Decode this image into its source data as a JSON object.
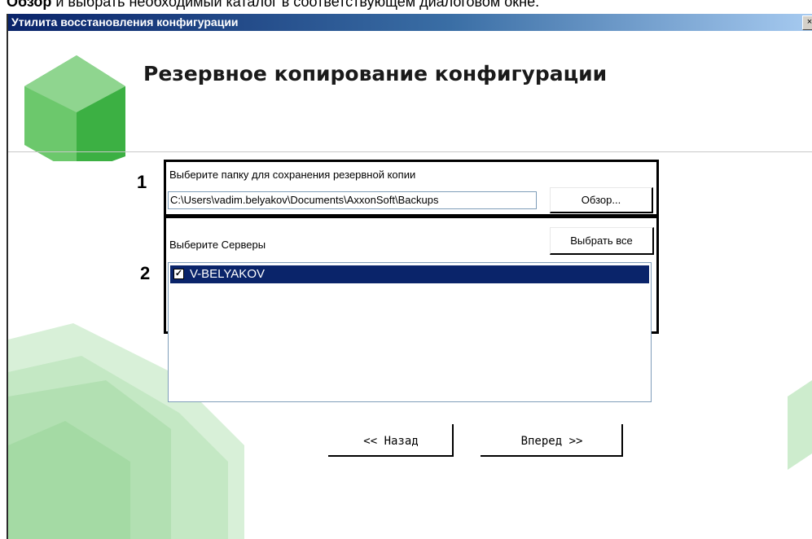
{
  "doc_caption": {
    "bold": "Обзор",
    "rest": " и выбрать необходимый каталог в соответствующем диалоговом окне."
  },
  "window": {
    "title": "Утилита восстановления конфигурации",
    "close_glyph": "×",
    "heading": "Резервное копирование конфигурации"
  },
  "step1": {
    "number": "1",
    "label": "Выберите папку для сохранения резервной копии",
    "path_value": "C:\\Users\\vadim.belyakov\\Documents\\AxxonSoft\\Backups",
    "browse_label": "Обзор..."
  },
  "step2": {
    "number": "2",
    "label": "Выберите Серверы",
    "select_all_label": "Выбрать все",
    "servers": [
      {
        "name": "V-BELYAKOV",
        "checked": true,
        "selected": true
      }
    ]
  },
  "nav": {
    "back_label": "<< Назад",
    "next_label": "Вперед >>"
  },
  "colors": {
    "title_bar": "#0a246a",
    "selection": "#0a246a",
    "logo_green_light": "#8fd58f",
    "logo_green_dark": "#3cb043"
  },
  "icons": {
    "logo": "green-cube-logo-icon",
    "checkbox": "checkmark-icon",
    "close": "close-icon"
  }
}
